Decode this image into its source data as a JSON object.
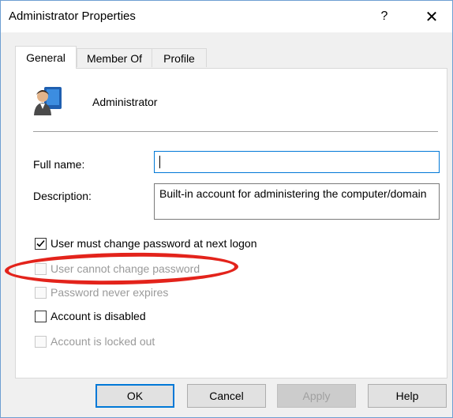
{
  "window": {
    "title": "Administrator Properties",
    "help_label": "?",
    "close_label": "✕"
  },
  "tabs": [
    {
      "label": "General",
      "active": true
    },
    {
      "label": "Member Of",
      "active": false
    },
    {
      "label": "Profile",
      "active": false
    }
  ],
  "user": {
    "icon": "user-icon",
    "name": "Administrator"
  },
  "fields": {
    "full_name_label": "Full name:",
    "full_name_value": "",
    "description_label": "Description:",
    "description_value": "Built-in account for administering the computer/domain"
  },
  "checkboxes": [
    {
      "label": "User must change password at next logon",
      "checked": true,
      "enabled": true
    },
    {
      "label": "User cannot change password",
      "checked": false,
      "enabled": false
    },
    {
      "label": "Password never expires",
      "checked": false,
      "enabled": false
    },
    {
      "label": "Account is disabled",
      "checked": false,
      "enabled": true
    },
    {
      "label": "Account is locked out",
      "checked": false,
      "enabled": false
    }
  ],
  "highlight": {
    "color": "#e3231b"
  },
  "buttons": {
    "ok": "OK",
    "cancel": "Cancel",
    "apply": "Apply",
    "help": "Help"
  }
}
